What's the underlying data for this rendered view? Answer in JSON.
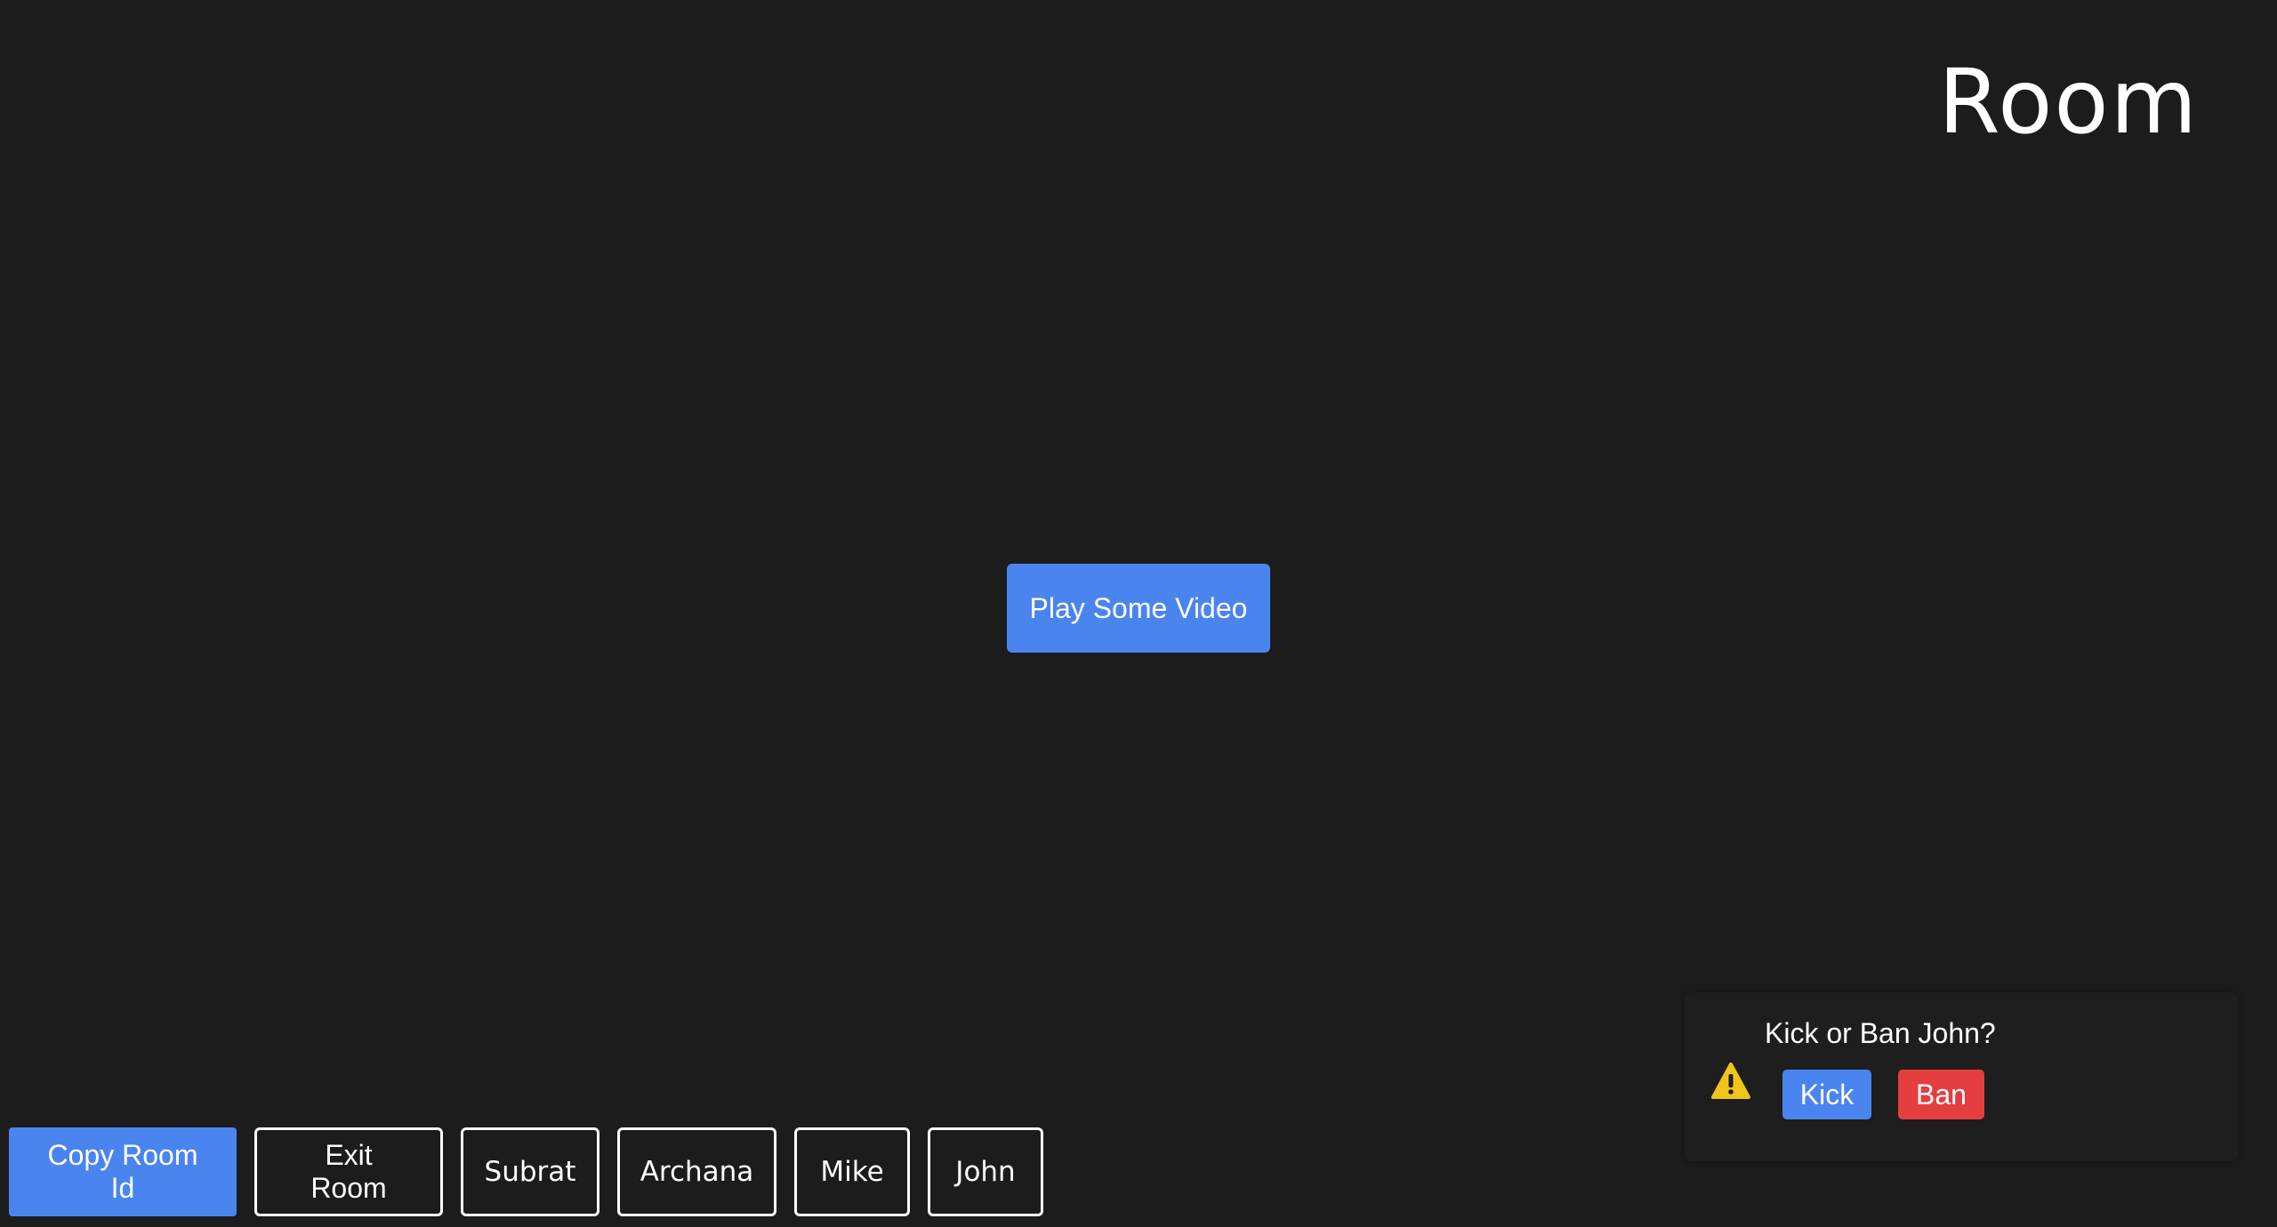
{
  "header": {
    "title": "Room"
  },
  "main": {
    "play_label": "Play Some Video"
  },
  "bottom_bar": {
    "copy_label": "Copy Room Id",
    "exit_label": "Exit Room",
    "members": [
      "Subrat",
      "Archana",
      "Mike",
      "John"
    ]
  },
  "toast": {
    "message": "Kick or Ban John?",
    "kick_label": "Kick",
    "ban_label": "Ban",
    "icon": "warning-icon"
  },
  "colors": {
    "background": "#1c1c1c",
    "accent": "#4a84ef",
    "danger": "#e53e3e",
    "warning": "#f0c419"
  }
}
